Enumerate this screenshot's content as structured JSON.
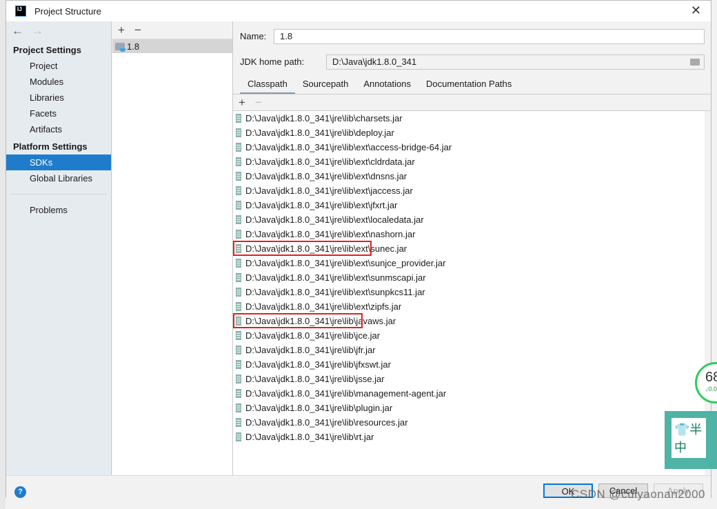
{
  "window": {
    "title": "Project Structure",
    "logo": "IJ"
  },
  "sidebar": {
    "project_settings": "Project Settings",
    "project_items": [
      "Project",
      "Modules",
      "Libraries",
      "Facets",
      "Artifacts"
    ],
    "platform_settings": "Platform Settings",
    "platform_items": [
      "SDKs",
      "Global Libraries"
    ],
    "problems": "Problems",
    "selected": "SDKs"
  },
  "sdk_list": {
    "items": [
      "1.8"
    ]
  },
  "details": {
    "name_label": "Name:",
    "name_value": "1.8",
    "home_label": "JDK home path:",
    "home_value": "D:\\Java\\jdk1.8.0_341",
    "tabs": [
      "Classpath",
      "Sourcepath",
      "Annotations",
      "Documentation Paths"
    ],
    "selected_tab": "Classpath",
    "classpath": [
      "D:\\Java\\jdk1.8.0_341\\jre\\lib\\charsets.jar",
      "D:\\Java\\jdk1.8.0_341\\jre\\lib\\deploy.jar",
      "D:\\Java\\jdk1.8.0_341\\jre\\lib\\ext\\access-bridge-64.jar",
      "D:\\Java\\jdk1.8.0_341\\jre\\lib\\ext\\cldrdata.jar",
      "D:\\Java\\jdk1.8.0_341\\jre\\lib\\ext\\dnsns.jar",
      "D:\\Java\\jdk1.8.0_341\\jre\\lib\\ext\\jaccess.jar",
      "D:\\Java\\jdk1.8.0_341\\jre\\lib\\ext\\jfxrt.jar",
      "D:\\Java\\jdk1.8.0_341\\jre\\lib\\ext\\localedata.jar",
      "D:\\Java\\jdk1.8.0_341\\jre\\lib\\ext\\nashorn.jar",
      "D:\\Java\\jdk1.8.0_341\\jre\\lib\\ext\\sunec.jar",
      "D:\\Java\\jdk1.8.0_341\\jre\\lib\\ext\\sunjce_provider.jar",
      "D:\\Java\\jdk1.8.0_341\\jre\\lib\\ext\\sunmscapi.jar",
      "D:\\Java\\jdk1.8.0_341\\jre\\lib\\ext\\sunpkcs11.jar",
      "D:\\Java\\jdk1.8.0_341\\jre\\lib\\ext\\zipfs.jar",
      "D:\\Java\\jdk1.8.0_341\\jre\\lib\\javaws.jar",
      "D:\\Java\\jdk1.8.0_341\\jre\\lib\\jce.jar",
      "D:\\Java\\jdk1.8.0_341\\jre\\lib\\jfr.jar",
      "D:\\Java\\jdk1.8.0_341\\jre\\lib\\jfxswt.jar",
      "D:\\Java\\jdk1.8.0_341\\jre\\lib\\jsse.jar",
      "D:\\Java\\jdk1.8.0_341\\jre\\lib\\management-agent.jar",
      "D:\\Java\\jdk1.8.0_341\\jre\\lib\\plugin.jar",
      "D:\\Java\\jdk1.8.0_341\\jre\\lib\\resources.jar",
      "D:\\Java\\jdk1.8.0_341\\jre\\lib\\rt.jar"
    ],
    "highlighted_rows": [
      9,
      14
    ]
  },
  "buttons": {
    "ok": "OK",
    "cancel": "Cancel",
    "apply": "Apply",
    "help": "?"
  },
  "overlay": {
    "widget_value": "68",
    "widget_sub": "↓0.0",
    "ime_chars": [
      "半",
      "中"
    ],
    "watermark": "CSDN @cuiyaonan2000"
  },
  "colors": {
    "selection": "#1f7ccc",
    "highlight_box": "#e02020"
  }
}
